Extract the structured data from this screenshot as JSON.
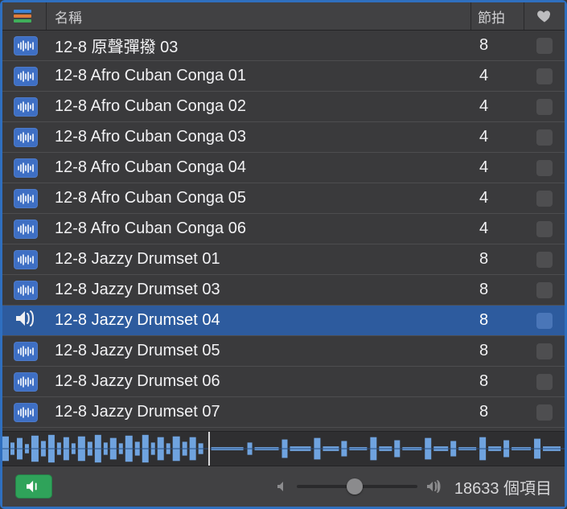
{
  "header": {
    "name_label": "名稱",
    "beats_label": "節拍"
  },
  "selected_index": 10,
  "rows": [
    {
      "name": "12-8 原聲彈撥 03",
      "beats": "8"
    },
    {
      "name": "12-8 Afro Cuban Conga 01",
      "beats": "4"
    },
    {
      "name": "12-8 Afro Cuban Conga 02",
      "beats": "4"
    },
    {
      "name": "12-8 Afro Cuban Conga 03",
      "beats": "4"
    },
    {
      "name": "12-8 Afro Cuban Conga 04",
      "beats": "4"
    },
    {
      "name": "12-8 Afro Cuban Conga 05",
      "beats": "4"
    },
    {
      "name": "12-8 Afro Cuban Conga 06",
      "beats": "4"
    },
    {
      "name": "12-8 Jazzy Drumset 01",
      "beats": "8"
    },
    {
      "name": "12-8 Jazzy Drumset 03",
      "beats": "8"
    },
    {
      "name": "12-8 Jazzy Drumset 04",
      "beats": "8"
    },
    {
      "name": "12-8 Jazzy Drumset 05",
      "beats": "8"
    },
    {
      "name": "12-8 Jazzy Drumset 06",
      "beats": "8"
    },
    {
      "name": "12-8 Jazzy Drumset 07",
      "beats": "8"
    }
  ],
  "footer": {
    "item_count": "18633 個項目",
    "volume_percent": 48
  }
}
